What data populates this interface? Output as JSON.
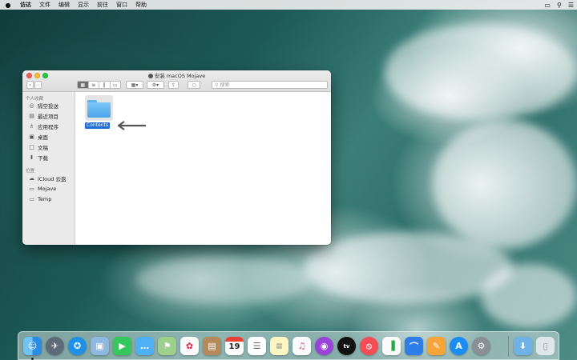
{
  "menubar": {
    "apple": "",
    "items": [
      "访达",
      "文件",
      "编辑",
      "显示",
      "前往",
      "窗口",
      "帮助"
    ],
    "right_icons": [
      "airplay-icon",
      "search-icon",
      "menu-icon"
    ]
  },
  "window": {
    "title": "安装 macOS Mojave",
    "search_placeholder": "搜索",
    "sidebar": {
      "favorites_header": "个人收藏",
      "favorites": [
        {
          "label": "隔空投送",
          "icon": "airdrop-icon"
        },
        {
          "label": "最近项目",
          "icon": "recents-icon"
        },
        {
          "label": "应用程序",
          "icon": "applications-icon"
        },
        {
          "label": "桌面",
          "icon": "desktop-icon"
        },
        {
          "label": "文稿",
          "icon": "documents-icon"
        },
        {
          "label": "下载",
          "icon": "downloads-icon"
        }
      ],
      "locations_header": "位置",
      "locations": [
        {
          "label": "iCloud 云盘",
          "icon": "icloud-icon"
        },
        {
          "label": "Mojave",
          "icon": "disk-icon"
        },
        {
          "label": "Temp",
          "icon": "disk-icon"
        }
      ]
    },
    "content": {
      "items": [
        {
          "label": "Contents",
          "icon": "folder-icon",
          "selected": true
        }
      ]
    }
  },
  "dock": {
    "apps": [
      "Finder",
      "Launchpad",
      "Safari",
      "Preview",
      "FaceTime",
      "Messages",
      "Maps",
      "Photos",
      "Contacts",
      "Calendar",
      "Reminders",
      "Notes",
      "Music",
      "Podcasts",
      "TV",
      "News",
      "Numbers",
      "Keynote",
      "Pages",
      "App Store",
      "System Preferences",
      "Downloads",
      "Trash"
    ],
    "calendar_day": "19",
    "tv_label": "tv",
    "colors": {
      "accent": "#1f6fd8"
    }
  }
}
